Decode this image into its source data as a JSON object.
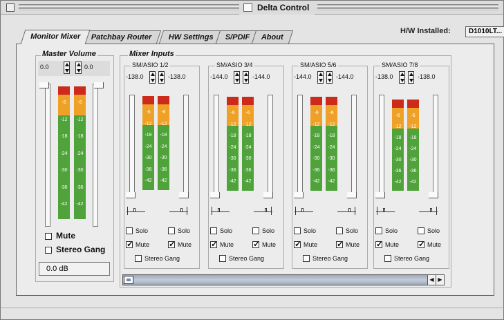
{
  "window": {
    "title": "Delta Control"
  },
  "tabs": [
    {
      "label": "Monitor Mixer",
      "active": true
    },
    {
      "label": "Patchbay Router",
      "active": false
    },
    {
      "label": "HW Settings",
      "active": false
    },
    {
      "label": "S/PDIF",
      "active": false
    },
    {
      "label": "About",
      "active": false
    }
  ],
  "hardware": {
    "label": "H/W Installed:",
    "value": "D1010LT..."
  },
  "master": {
    "title": "Master Volume",
    "left_value": "0.0",
    "right_value": "0.0",
    "mute_label": "Mute",
    "mute_checked": false,
    "stereo_gang_label": "Stereo Gang",
    "stereo_gang_checked": false,
    "db_readout": "0.0 dB"
  },
  "mixer": {
    "title": "Mixer Inputs",
    "scale_ticks": [
      "-6",
      "-12",
      "-18",
      "-24",
      "-30",
      "-36",
      "-42"
    ],
    "channels": [
      {
        "name": "SM/ASIO 1/2",
        "left": "-138.0",
        "right": "-138.0",
        "solo_label": "Solo",
        "mute_label": "Mute",
        "gang_label": "Stereo Gang",
        "mute": [
          true,
          true
        ],
        "solo": [
          false,
          false
        ],
        "gang": false
      },
      {
        "name": "SM/ASIO 3/4",
        "left": "-144.0",
        "right": "-144.0",
        "solo_label": "Solo",
        "mute_label": "Mute",
        "gang_label": "Stereo Gang",
        "mute": [
          true,
          true
        ],
        "solo": [
          false,
          false
        ],
        "gang": false
      },
      {
        "name": "SM/ASIO 5/6",
        "left": "-144.0",
        "right": "-144.0",
        "solo_label": "Solo",
        "mute_label": "Mute",
        "gang_label": "Stereo Gang",
        "mute": [
          true,
          true
        ],
        "solo": [
          false,
          false
        ],
        "gang": false
      },
      {
        "name": "SM/ASIO 7/8",
        "left": "-138.0",
        "right": "-138.0",
        "solo_label": "Solo",
        "mute_label": "Mute",
        "gang_label": "Stereo Gang",
        "mute": [
          true,
          true
        ],
        "solo": [
          false,
          false
        ],
        "gang": false
      }
    ]
  },
  "icons": {
    "window": "window-icon",
    "scroll_left": "arrow-left-icon",
    "scroll_right": "arrow-right-icon"
  }
}
